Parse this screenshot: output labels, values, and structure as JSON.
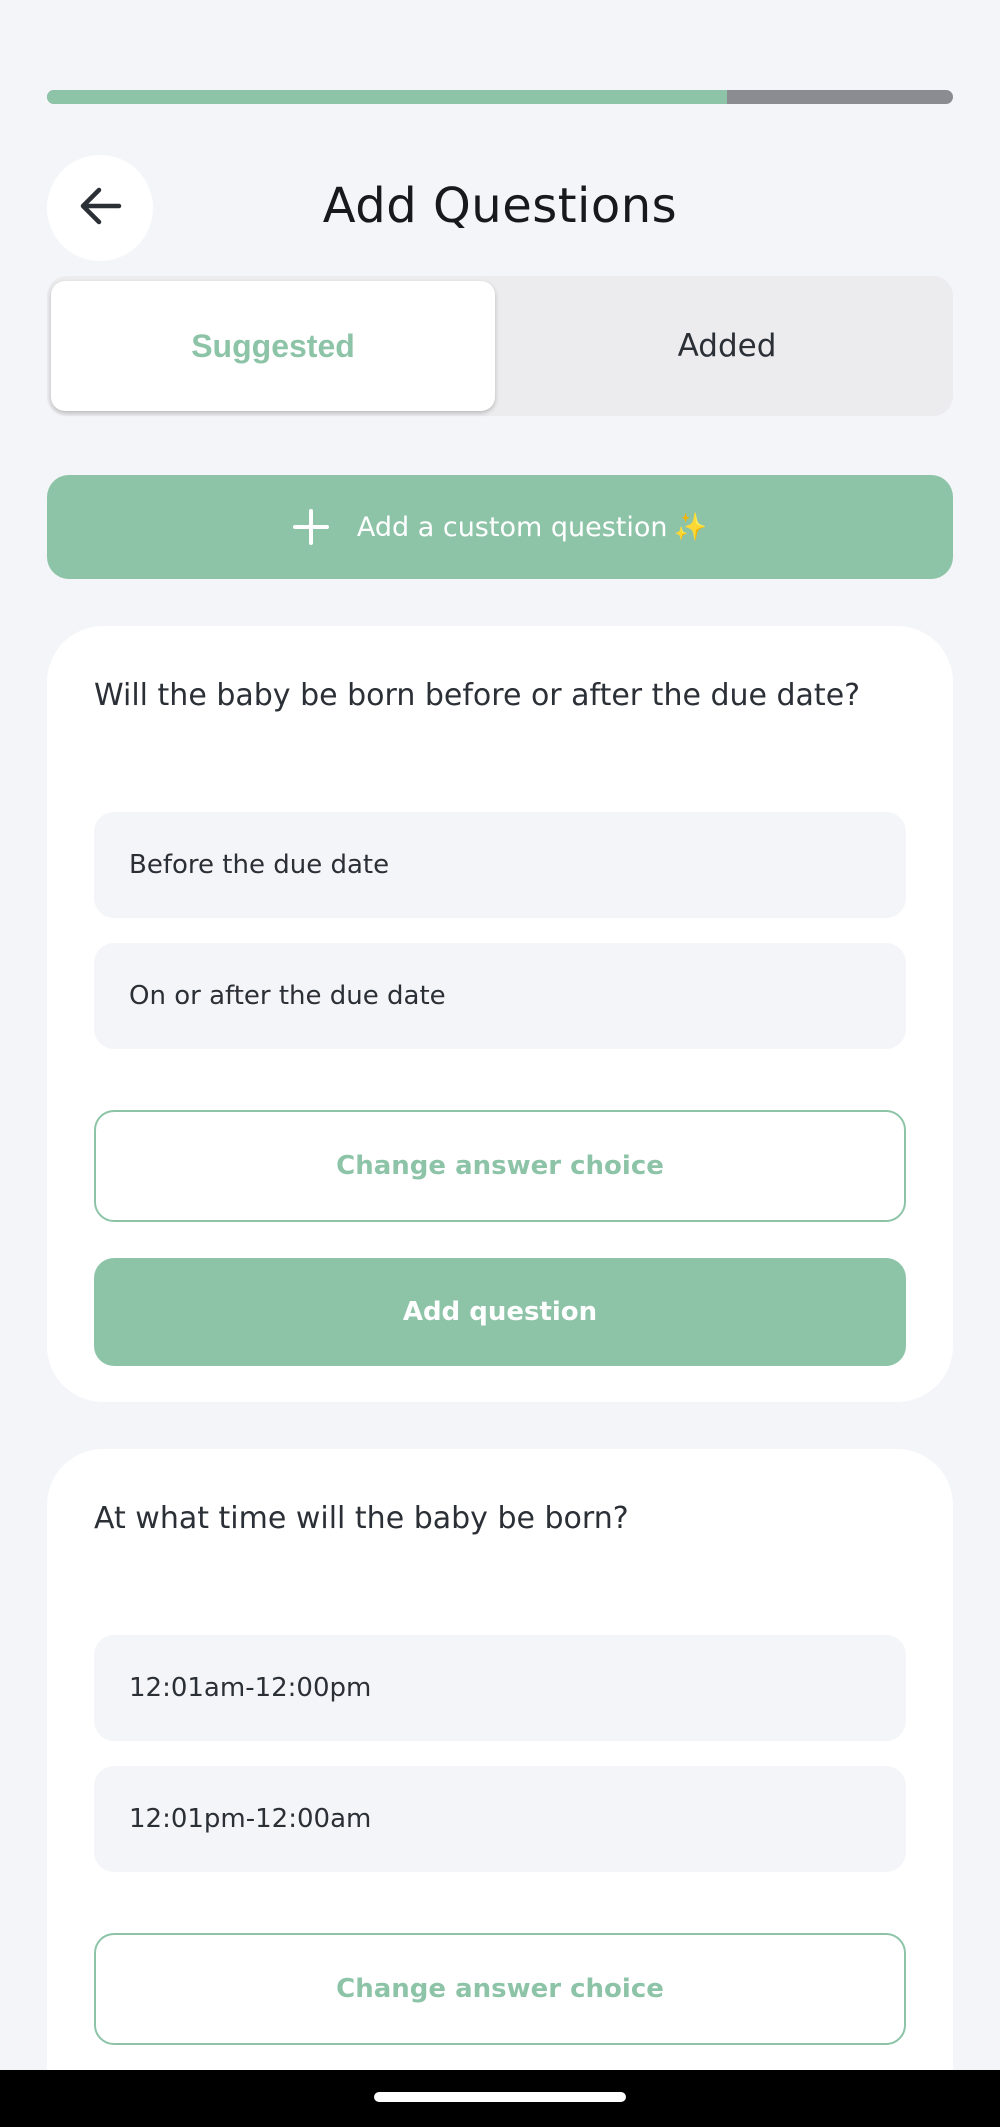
{
  "progress": {
    "value_percent": 75
  },
  "header": {
    "back_icon": "arrow-left-icon",
    "title": "Add Questions"
  },
  "tabs": [
    {
      "label": "Suggested",
      "selected": true
    },
    {
      "label": "Added",
      "selected": false
    }
  ],
  "custom_question": {
    "icon": "plus-icon",
    "label": "Add a custom question",
    "emoji": "✨"
  },
  "questions": [
    {
      "text": "Will the baby be born before or after the due date?",
      "options": [
        "Before the due date",
        "On or after the due date"
      ],
      "change_label": "Change answer choice",
      "add_label": "Add question"
    },
    {
      "text": "At what time will the baby be born?",
      "options": [
        "12:01am-12:00pm",
        "12:01pm-12:00am"
      ],
      "change_label": "Change answer choice"
    }
  ],
  "colors": {
    "accent": "#8dc4a8",
    "background": "#f4f5f9",
    "card": "#ffffff",
    "option_bg": "#f4f5f8",
    "progress_track": "#8b8c91",
    "text": "#2b2f36"
  }
}
